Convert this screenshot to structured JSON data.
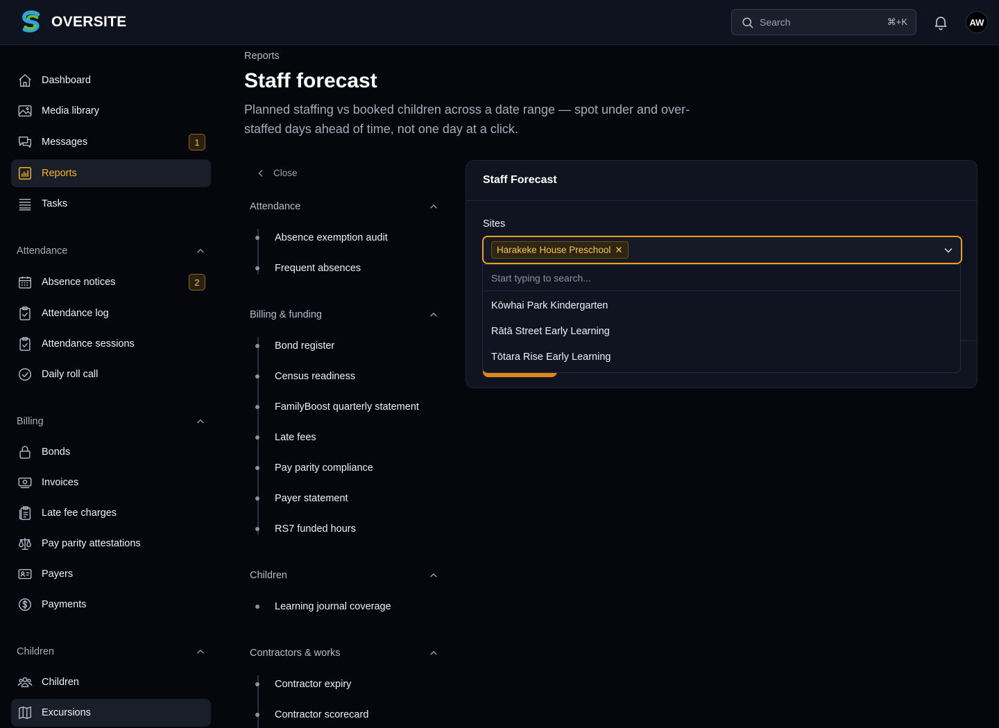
{
  "app": {
    "name": "OVERSITE"
  },
  "header": {
    "search_placeholder": "Search",
    "search_shortcut": "⌘+K",
    "avatar_initials": "AW"
  },
  "sidebar": {
    "main_items": [
      {
        "label": "Dashboard",
        "icon": "home-icon"
      },
      {
        "label": "Media library",
        "icon": "image-icon"
      },
      {
        "label": "Messages",
        "icon": "chat-icon",
        "badge": "1"
      },
      {
        "label": "Reports",
        "icon": "chart-icon",
        "active": true
      },
      {
        "label": "Tasks",
        "icon": "list-icon"
      }
    ],
    "sections": [
      {
        "title": "Attendance",
        "items": [
          {
            "label": "Absence notices",
            "icon": "calendar-icon",
            "badge": "2"
          },
          {
            "label": "Attendance log",
            "icon": "clipboard-check-icon"
          },
          {
            "label": "Attendance sessions",
            "icon": "clipboard-check-icon"
          },
          {
            "label": "Daily roll call",
            "icon": "check-circle-icon"
          }
        ]
      },
      {
        "title": "Billing",
        "items": [
          {
            "label": "Bonds",
            "icon": "lock-icon"
          },
          {
            "label": "Invoices",
            "icon": "banknote-icon"
          },
          {
            "label": "Late fee charges",
            "icon": "clipboard-list-icon"
          },
          {
            "label": "Pay parity attestations",
            "icon": "scale-icon"
          },
          {
            "label": "Payers",
            "icon": "id-card-icon"
          },
          {
            "label": "Payments",
            "icon": "dollar-circle-icon"
          }
        ]
      },
      {
        "title": "Children",
        "items": [
          {
            "label": "Children",
            "icon": "users-icon"
          },
          {
            "label": "Excursions",
            "icon": "map-icon",
            "active": true
          }
        ]
      }
    ]
  },
  "page": {
    "breadcrumb": "Reports",
    "title": "Staff forecast",
    "subtitle": "Planned staffing vs booked children across a date range — spot under and over-staffed days ahead of time, not one day at a click."
  },
  "report_tree": {
    "close_label": "Close",
    "groups": [
      {
        "title": "Attendance",
        "items": [
          "Absence exemption audit",
          "Frequent absences"
        ]
      },
      {
        "title": "Billing & funding",
        "items": [
          "Bond register",
          "Census readiness",
          "FamilyBoost quarterly statement",
          "Late fees",
          "Pay parity compliance",
          "Payer statement",
          "RS7 funded hours"
        ]
      },
      {
        "title": "Children",
        "items": [
          "Learning journal coverage"
        ]
      },
      {
        "title": "Contractors & works",
        "items": [
          "Contractor expiry",
          "Contractor scorecard"
        ]
      }
    ]
  },
  "form": {
    "card_title": "Staff Forecast",
    "sites_label": "Sites",
    "selected_sites": [
      "Harakeke House Preschool"
    ],
    "dropdown_search_placeholder": "Start typing to search...",
    "options": [
      "Kōwhai Park Kindergarten",
      "Rātā Street Early Learning",
      "Tōtara Rise Early Learning"
    ]
  },
  "colors": {
    "accent": "#f5b42a",
    "focus_border": "#f0a020",
    "background": "#05070d",
    "header_bg": "#0e131f"
  }
}
